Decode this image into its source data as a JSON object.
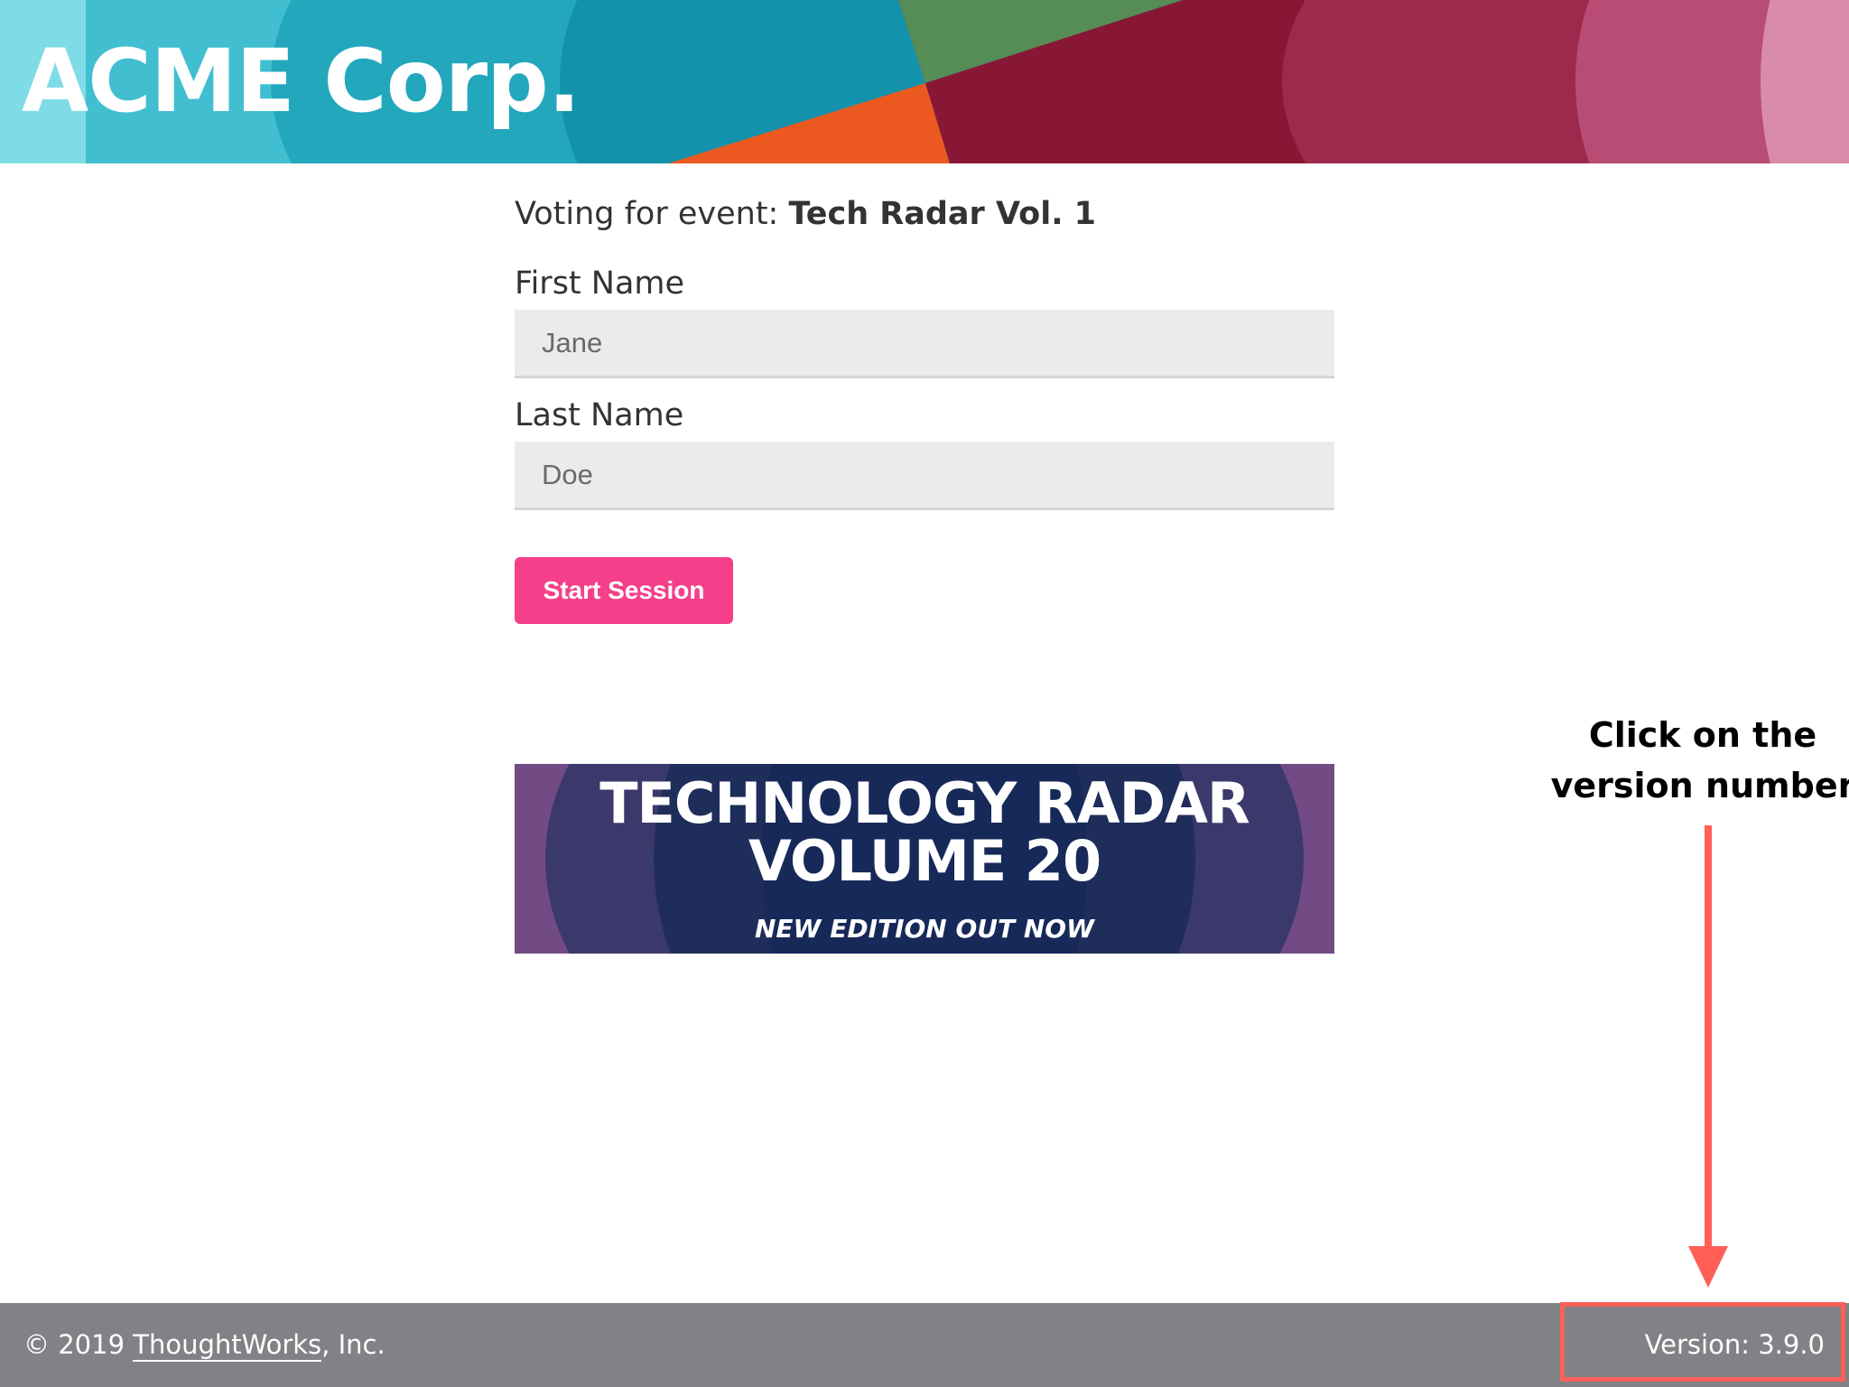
{
  "header": {
    "brand": "ACME Corp.",
    "colors": [
      "#7fdce6",
      "#41bfd1",
      "#23a7bd",
      "#1492ab",
      "#568c55",
      "#eb5921",
      "#881735",
      "#9d2a4d",
      "#b84c74",
      "#d98ca9"
    ]
  },
  "voting": {
    "label": "Voting for event:",
    "event_name": "Tech Radar Vol. 1"
  },
  "form": {
    "first_name_label": "First Name",
    "first_name_placeholder": "Jane",
    "last_name_label": "Last Name",
    "last_name_placeholder": "Doe",
    "start_button": "Start Session",
    "button_color": "#f53f8a"
  },
  "radar_banner": {
    "line1": "TECHNOLOGY RADAR",
    "line2": "VOLUME 20",
    "subtitle": "NEW EDITION OUT NOW"
  },
  "annotation": {
    "line1": "Click on the",
    "line2": "version number",
    "color": "#ff5f57"
  },
  "footer": {
    "copyright_prefix": "© 2019 ",
    "company_link": "ThoughtWorks",
    "copyright_suffix": ", Inc.",
    "version": "Version: 3.9.0",
    "background": "#808285"
  }
}
